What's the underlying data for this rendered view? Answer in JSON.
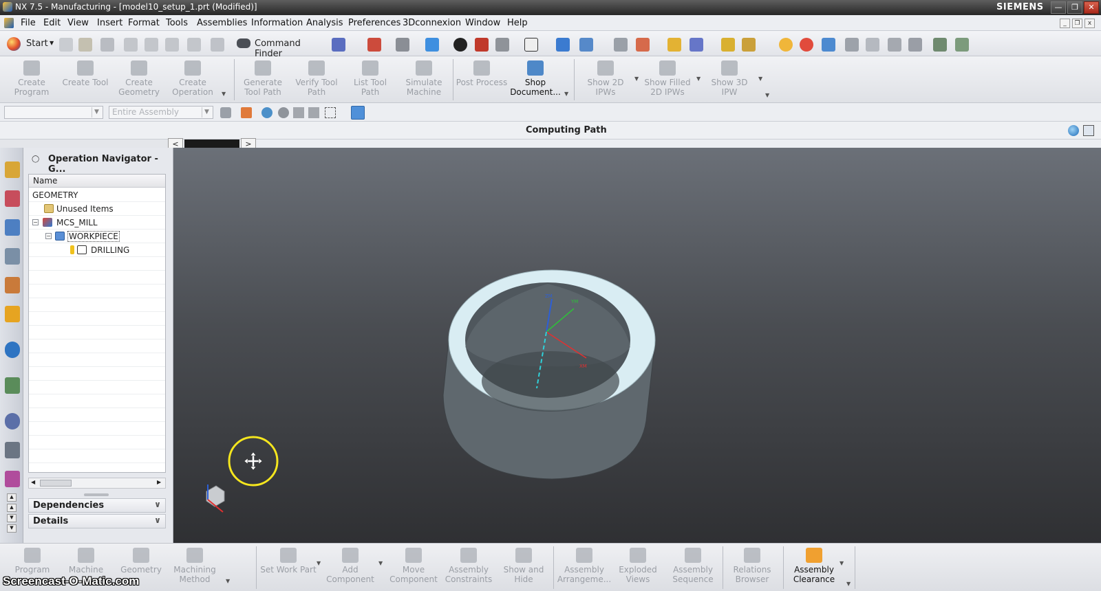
{
  "window": {
    "title": "NX 7.5 - Manufacturing - [model10_setup_1.prt (Modified)]",
    "brand": "SIEMENS",
    "controls": [
      "minimize",
      "restore",
      "close"
    ]
  },
  "menubar": {
    "items": [
      "File",
      "Edit",
      "View",
      "Insert",
      "Format",
      "Tools",
      "Assemblies",
      "Information",
      "Analysis",
      "Preferences",
      "3Dconnexion",
      "Window",
      "Help"
    ]
  },
  "standard_toolbar": {
    "start_label": "Start",
    "command_finder_label": "Command Finder"
  },
  "manufacturing_toolbar": {
    "buttons": [
      {
        "label": "Create Program",
        "enabled": false,
        "icon": "program-icon"
      },
      {
        "label": "Create Tool",
        "enabled": false,
        "icon": "tool-icon"
      },
      {
        "label": "Create Geometry",
        "enabled": false,
        "icon": "geometry-icon"
      },
      {
        "label": "Create Operation",
        "enabled": false,
        "icon": "operation-icon"
      },
      {
        "label": "Generate Tool Path",
        "enabled": false,
        "icon": "generate-path-icon"
      },
      {
        "label": "Verify Tool Path",
        "enabled": false,
        "icon": "verify-path-icon"
      },
      {
        "label": "List Tool Path",
        "enabled": false,
        "icon": "list-path-icon"
      },
      {
        "label": "Simulate Machine",
        "enabled": false,
        "icon": "simulate-icon"
      },
      {
        "label": "Post Process",
        "enabled": false,
        "icon": "post-process-icon"
      },
      {
        "label": "Shop Document...",
        "enabled": true,
        "icon": "shop-document-icon"
      },
      {
        "label": "Show 2D IPWs",
        "enabled": false,
        "icon": "ipw-2d-icon"
      },
      {
        "label": "Show Filled 2D IPWs",
        "enabled": false,
        "icon": "ipw-filled-icon"
      },
      {
        "label": "Show 3D IPW",
        "enabled": false,
        "icon": "ipw-3d-icon"
      }
    ]
  },
  "selection_bar": {
    "filter_value": "",
    "scope_value": "Entire Assembly"
  },
  "status": {
    "message": "Computing Path"
  },
  "navigator": {
    "title": "Operation Navigator - G...",
    "column_header": "Name",
    "rows": [
      {
        "label": "GEOMETRY",
        "level": 0,
        "icon": ""
      },
      {
        "label": "Unused Items",
        "level": 1,
        "icon": "folder-icon"
      },
      {
        "label": "MCS_MILL",
        "level": 1,
        "icon": "mcs-icon",
        "expanded": true
      },
      {
        "label": "WORKPIECE",
        "level": 2,
        "icon": "workpiece-icon",
        "expanded": true,
        "selected": true
      },
      {
        "label": "DRILLING",
        "level": 3,
        "icon": "drilling-op-icon"
      }
    ],
    "panels": [
      "Dependencies",
      "Details"
    ]
  },
  "viewport": {
    "axis_labels": [
      "ZM",
      "YM",
      "XM"
    ],
    "part": "hollow cylinder"
  },
  "assembly_toolbar": {
    "buttons": [
      {
        "label": "Program",
        "enabled": false
      },
      {
        "label": "Machine",
        "enabled": false
      },
      {
        "label": "Geometry",
        "enabled": false
      },
      {
        "label": "Machining Method",
        "enabled": false
      },
      {
        "label": "Set Work Part",
        "enabled": false
      },
      {
        "label": "Add Component",
        "enabled": false
      },
      {
        "label": "Move Component",
        "enabled": false
      },
      {
        "label": "Assembly Constraints",
        "enabled": false
      },
      {
        "label": "Show and Hide",
        "enabled": false
      },
      {
        "label": "Assembly Arrangeme...",
        "enabled": false
      },
      {
        "label": "Exploded Views",
        "enabled": false
      },
      {
        "label": "Assembly Sequence",
        "enabled": false
      },
      {
        "label": "Relations Browser",
        "enabled": false
      },
      {
        "label": "Assembly Clearance",
        "enabled": true
      }
    ]
  },
  "watermark": "Screencast-O-Matic.com",
  "colors": {
    "accent": "#4e88c8",
    "part_face": "#d8ecf2",
    "part_body": "#5e686e",
    "cursor_ring": "#f5e61e"
  }
}
